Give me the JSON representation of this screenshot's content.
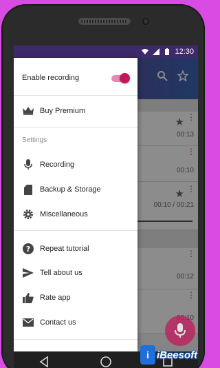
{
  "status_bar": {
    "time": "12:30"
  },
  "drawer": {
    "enable_recording_label": "Enable recording",
    "enable_recording_on": true,
    "buy_premium_label": "Buy Premium",
    "settings_header": "Settings",
    "settings_items": [
      {
        "label": "Recording",
        "icon": "microphone-icon"
      },
      {
        "label": "Backup & Storage",
        "icon": "sd-card-icon"
      },
      {
        "label": "Miscellaneous",
        "icon": "gear-icon"
      }
    ],
    "other_items": [
      {
        "label": "Repeat tutorial",
        "icon": "help-icon"
      },
      {
        "label": "Tell about us",
        "icon": "send-icon"
      },
      {
        "label": "Rate app",
        "icon": "thumbs-up-icon"
      },
      {
        "label": "Contact us",
        "icon": "mail-icon"
      }
    ]
  },
  "recordings": [
    {
      "duration": "00:13",
      "starred": true
    },
    {
      "duration": "00:10",
      "starred": false
    },
    {
      "duration": "00:10 / 00:21",
      "starred": true
    },
    {
      "duration": "00:12",
      "starred": false
    },
    {
      "duration": "00:10",
      "starred": false
    }
  ],
  "colors": {
    "accent": "#c2185b",
    "toggle_track": "#e38bb0",
    "background": "#d94ce3"
  },
  "watermark": {
    "text": "iBeesoft"
  }
}
